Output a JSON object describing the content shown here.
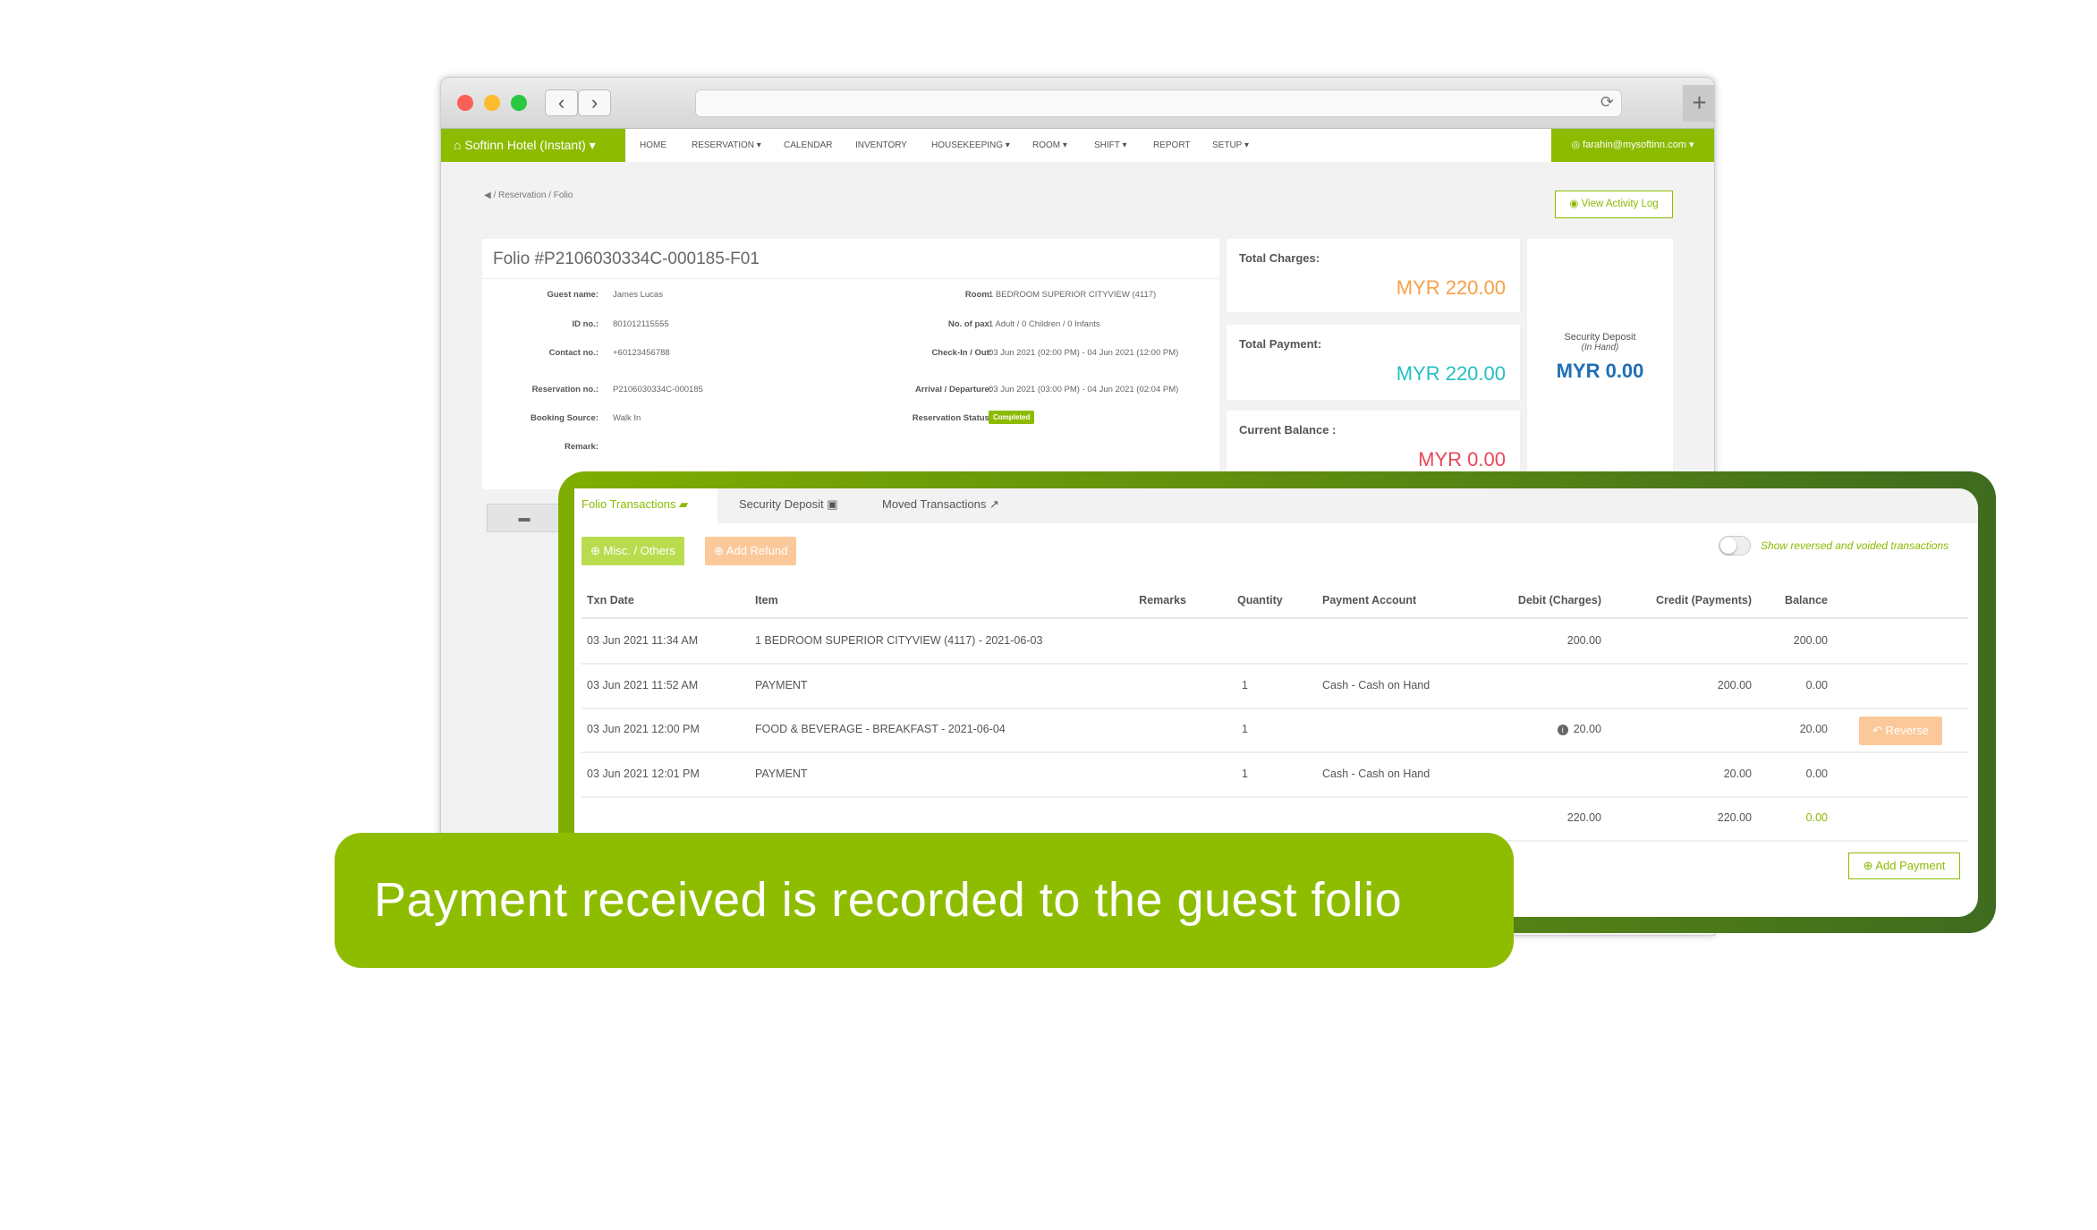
{
  "browser": {
    "back_icon": "‹",
    "forward_icon": "›",
    "reload_icon": "⟳",
    "new_tab_icon": "+"
  },
  "nav": {
    "brand": "Softinn Hotel (Instant)",
    "items": [
      "HOME",
      "RESERVATION ▾",
      "CALENDAR",
      "INVENTORY",
      "HOUSEKEEPING ▾",
      "ROOM ▾",
      "SHIFT ▾",
      "REPORT",
      "SETUP ▾"
    ],
    "user": "farahin@mysoftinn.com"
  },
  "breadcrumb": [
    "Reservation",
    "Folio"
  ],
  "activity_log": "View Activity Log",
  "folio": {
    "title": "Folio #P2106030334C-000185-F01",
    "left": [
      [
        "Guest name:",
        "James Lucas"
      ],
      [
        "ID no.:",
        "801012115555"
      ],
      [
        "Contact no.:",
        "+60123456788"
      ],
      [
        "Reservation no.:",
        "P2106030334C-000185"
      ],
      [
        "Booking Source:",
        "Walk In"
      ],
      [
        "Remark:",
        ""
      ]
    ],
    "right": [
      [
        "Room:",
        "1 BEDROOM SUPERIOR CITYVIEW (4117)"
      ],
      [
        "No. of pax:",
        "1 Adult / 0 Children / 0 Infants"
      ],
      [
        "Check-In / Out:",
        "03 Jun 2021 (02:00 PM) - 04 Jun 2021 (12:00 PM)"
      ],
      [
        "Arrival / Departure:",
        "03 Jun 2021 (03:00 PM) - 04 Jun 2021 (02:04 PM)"
      ],
      [
        "Reservation Status:",
        ""
      ]
    ],
    "status": "Completed"
  },
  "summary": {
    "total_charges_label": "Total Charges:",
    "total_charges": "MYR 220.00",
    "total_payment_label": "Total Payment:",
    "total_payment": "MYR 220.00",
    "balance_label": "Current Balance :",
    "balance": "MYR 0.00",
    "deposit_label": "Security Deposit",
    "deposit_sub": "(In Hand)",
    "deposit": "MYR 0.00"
  },
  "colors": {
    "brand": "#8cbb00",
    "charges": "#f7a048",
    "payment": "#22bfc4",
    "balance": "#e8475a",
    "deposit": "#1f6fb5"
  },
  "tabs": [
    "Folio Transactions",
    "Security Deposit",
    "Moved Transactions"
  ],
  "buttons": {
    "misc": "Misc. / Others",
    "refund": "Add Refund",
    "toggle": "Show reversed and voided transactions",
    "reverse": "Reverse",
    "add_payment": "Add Payment"
  },
  "table": {
    "headers": [
      "Txn Date",
      "Item",
      "Remarks",
      "Quantity",
      "Payment Account",
      "Debit (Charges)",
      "Credit (Payments)",
      "Balance"
    ],
    "rows": [
      {
        "date": "03 Jun 2021 11:34 AM",
        "item": "1 BEDROOM SUPERIOR CITYVIEW (4117) - 2021-06-03",
        "qty": "",
        "account": "",
        "debit": "200.00",
        "credit": "",
        "balance": "200.00"
      },
      {
        "date": "03 Jun 2021 11:52 AM",
        "item": "PAYMENT",
        "qty": "1",
        "account": "Cash - Cash on Hand",
        "debit": "",
        "credit": "200.00",
        "balance": "0.00"
      },
      {
        "date": "03 Jun 2021 12:00 PM",
        "item": "FOOD & BEVERAGE - BREAKFAST - 2021-06-04",
        "qty": "1",
        "account": "",
        "debit": "20.00",
        "credit": "",
        "balance": "20.00"
      },
      {
        "date": "03 Jun 2021 12:01 PM",
        "item": "PAYMENT",
        "qty": "1",
        "account": "Cash - Cash on Hand",
        "debit": "",
        "credit": "20.00",
        "balance": "0.00"
      }
    ],
    "totals": {
      "debit": "220.00",
      "credit": "220.00",
      "balance": "0.00"
    }
  },
  "banner": "Payment received is recorded to the guest folio"
}
